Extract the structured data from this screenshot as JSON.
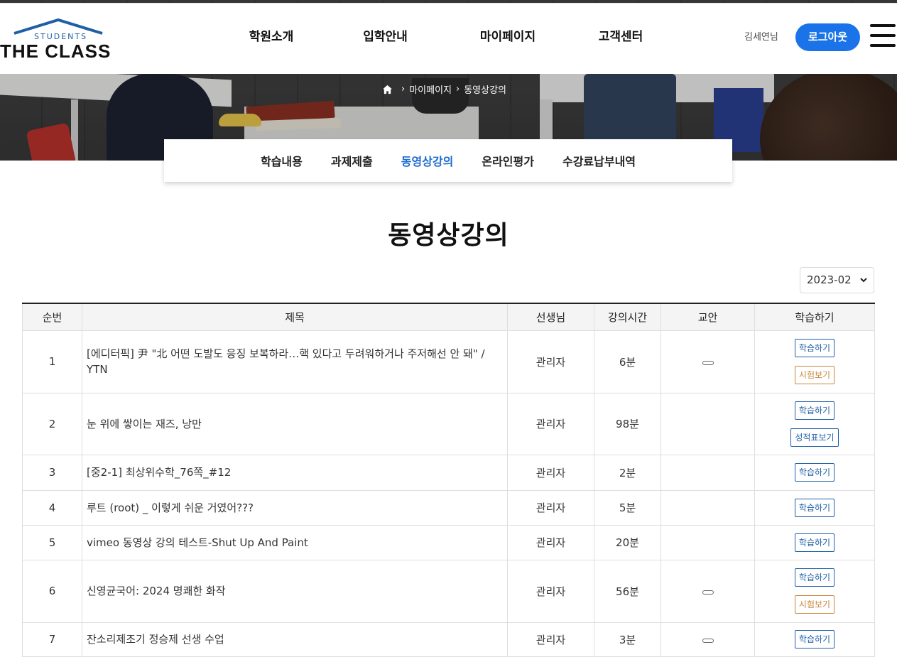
{
  "header": {
    "logo_students": "STUDENTS",
    "logo_brand": "THE CLASS",
    "nav": [
      "학원소개",
      "입학안내",
      "마이페이지",
      "고객센터"
    ],
    "username": "김세연님",
    "logout_label": "로그아웃"
  },
  "breadcrumb": [
    "마이페이지",
    "동영상강의"
  ],
  "subtabs": [
    {
      "label": "학습내용",
      "active": false
    },
    {
      "label": "과제제출",
      "active": false
    },
    {
      "label": "동영상강의",
      "active": true
    },
    {
      "label": "온라인평가",
      "active": false
    },
    {
      "label": "수강료납부내역",
      "active": false
    }
  ],
  "page_title": "동영상강의",
  "month_select": {
    "value": "2023-02"
  },
  "table": {
    "columns": [
      "순번",
      "제목",
      "선생님",
      "강의시간",
      "교안",
      "학습하기"
    ],
    "rows": [
      {
        "no": "1",
        "title": "[에디터픽] 尹 \"北 어떤 도발도 응징 보복하라…핵 있다고 두려워하거나 주저해선 안 돼\" / YTN",
        "teacher": "관리자",
        "time": "6분",
        "plan": true,
        "buttons": [
          {
            "type": "study",
            "label": "학습하기"
          },
          {
            "type": "exam",
            "label": "시험보기"
          }
        ]
      },
      {
        "no": "2",
        "title": "눈 위에 쌓이는 재즈, 낭만",
        "teacher": "관리자",
        "time": "98분",
        "plan": false,
        "buttons": [
          {
            "type": "study",
            "label": "학습하기"
          },
          {
            "type": "grade",
            "label": "성적표보기"
          }
        ]
      },
      {
        "no": "3",
        "title": "[중2-1] 최상위수학_76쪽_#12",
        "teacher": "관리자",
        "time": "2분",
        "plan": false,
        "buttons": [
          {
            "type": "study",
            "label": "학습하기"
          }
        ]
      },
      {
        "no": "4",
        "title": "루트 (root) _ 이렇게 쉬운 거였어???",
        "teacher": "관리자",
        "time": "5분",
        "plan": false,
        "buttons": [
          {
            "type": "study",
            "label": "학습하기"
          }
        ]
      },
      {
        "no": "5",
        "title": "vimeo 동영상 강의 테스트-Shut Up And Paint",
        "teacher": "관리자",
        "time": "20분",
        "plan": false,
        "buttons": [
          {
            "type": "study",
            "label": "학습하기"
          }
        ]
      },
      {
        "no": "6",
        "title": "신영균국어: 2024 명쾌한 화작",
        "teacher": "관리자",
        "time": "56분",
        "plan": true,
        "buttons": [
          {
            "type": "study",
            "label": "학습하기"
          },
          {
            "type": "exam",
            "label": "시험보기"
          }
        ]
      },
      {
        "no": "7",
        "title": "잔소리제조기 정승제 선생 수업",
        "teacher": "관리자",
        "time": "3분",
        "plan": true,
        "buttons": [
          {
            "type": "study",
            "label": "학습하기"
          }
        ]
      }
    ]
  },
  "colors": {
    "accent": "#1a73e8",
    "active_tab": "#1e6bd0",
    "study_btn": "#1f5fa8",
    "exam_btn": "#c9853b"
  }
}
